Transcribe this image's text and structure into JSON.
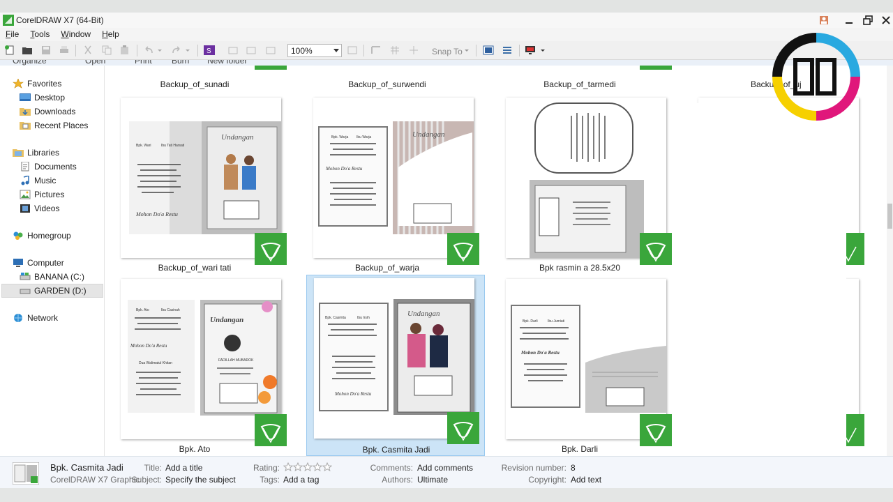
{
  "window": {
    "title": "CorelDRAW X7 (64-Bit)"
  },
  "menu": [
    {
      "label": "File",
      "key": "F",
      "rest": "ile"
    },
    {
      "label": "Tools",
      "key": "T",
      "rest": "ools"
    },
    {
      "label": "Window",
      "key": "W",
      "rest": "indow"
    },
    {
      "label": "Help",
      "key": "H",
      "rest": "elp"
    }
  ],
  "toolbar": {
    "zoom_value": "100%",
    "snap_to_label": "Snap To"
  },
  "command_bar": {
    "organize": "Organize",
    "open": "Open",
    "print": "Print",
    "burn": "Burn",
    "new_folder": "New folder"
  },
  "nav": {
    "favorites": "Favorites",
    "desktop": "Desktop",
    "downloads": "Downloads",
    "recent_places": "Recent Places",
    "libraries": "Libraries",
    "documents": "Documents",
    "music": "Music",
    "pictures": "Pictures",
    "videos": "Videos",
    "homegroup": "Homegroup",
    "computer": "Computer",
    "drive_c": "BANANA (C:)",
    "drive_d": "GARDEN (D:)",
    "network": "Network"
  },
  "files": {
    "row0": [
      "Backup_of_sunadi",
      "Backup_of_surwendi",
      "Backup_of_tarmedi",
      "Backup_of_uj"
    ],
    "row1": [
      "Backup_of_wari tati",
      "Backup_of_warja",
      "Bpk rasmin a 28.5x20"
    ],
    "row2": [
      "Bpk. Ato",
      "Bpk. Casmita Jadi",
      "Bpk. Darli"
    ]
  },
  "thumb_text": {
    "undangan": "Undangan",
    "mohon": "Mohon Do'a Restu",
    "bpk_wari": "Bpk. Wari",
    "ibu_tati": "Ibu Tati Harsati",
    "bpk_warja": "Bpk. Warja",
    "ibu_warja": "Ibu Warja",
    "bpk_ato": "Bpk. Ato",
    "ibu_casinah": "Ibu Casinah",
    "dua_walimatul": "Dua Walimatul Khitan",
    "fadillah": "FADILLAH MUBAROK",
    "bpk_casmita": "Bpk. Casmita",
    "ibu_irsih": "Ibu Irsih",
    "bpk_darli": "Bpk. Darli",
    "ibu_jumiati": "Ibu Jumiati",
    "mohon_darli": "Mohon Do'a Restu"
  },
  "details": {
    "file_name": "Bpk. Casmita Jadi",
    "file_type": "CorelDRAW X7 Graphic",
    "title_label": "Title:",
    "title_value": "Add a title",
    "subject_label": "Subject:",
    "subject_value": "Specify the subject",
    "rating_label": "Rating:",
    "rating_stars": 0,
    "tags_label": "Tags:",
    "tags_value": "Add a tag",
    "comments_label": "Comments:",
    "comments_value": "Add comments",
    "authors_label": "Authors:",
    "authors_value": "Ultimate",
    "revision_label": "Revision number:",
    "revision_value": "8",
    "copyright_label": "Copyright:",
    "copyright_value": "Add text"
  },
  "colors": {
    "corel_green": "#3aa63b",
    "selection": "#cce4f7",
    "logo_cyan": "#29a9e0",
    "logo_magenta": "#e0177b",
    "logo_yellow": "#f6d000"
  }
}
